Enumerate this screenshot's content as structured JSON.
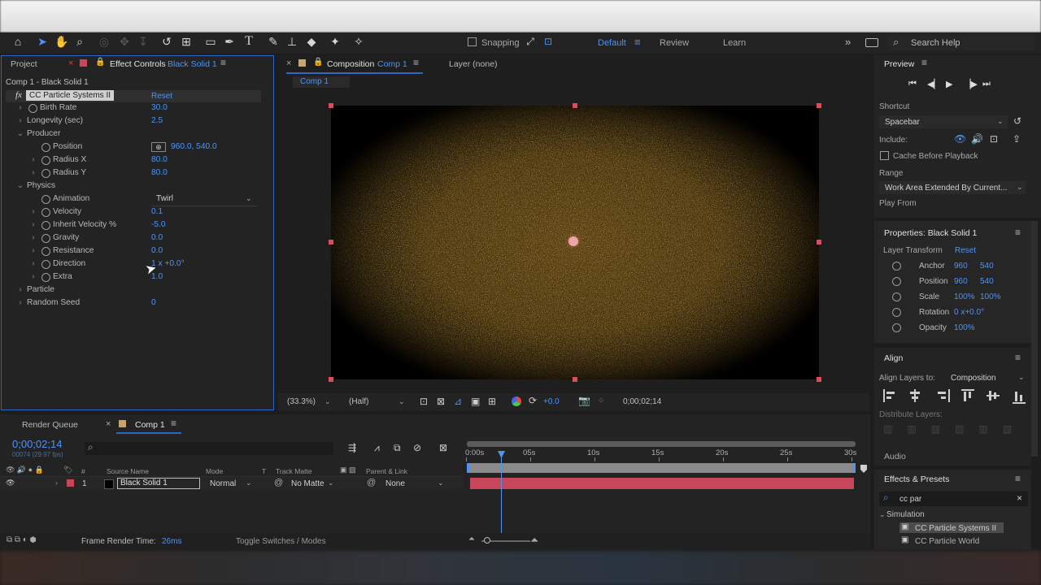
{
  "toolbar": {
    "snapping_label": "Snapping",
    "workspaces": [
      "Default",
      "Review",
      "Learn"
    ],
    "search_help": "Search Help"
  },
  "left_panel": {
    "tab_project": "Project",
    "tab_effect_controls": "Effect Controls",
    "tab_effect_layer": "Black Solid 1",
    "breadcrumb": "Comp 1 - Black Solid 1",
    "effect_name": "CC Particle Systems II",
    "reset": "Reset",
    "params": [
      {
        "label": "Birth Rate",
        "value": "30.0"
      },
      {
        "label": "Longevity (sec)",
        "value": "2.5"
      },
      {
        "label": "Producer",
        "value": ""
      },
      {
        "label": "Position",
        "value": "960.0, 540.0"
      },
      {
        "label": "Radius X",
        "value": "80.0"
      },
      {
        "label": "Radius Y",
        "value": "80.0"
      },
      {
        "label": "Physics",
        "value": ""
      },
      {
        "label": "Animation",
        "value": "Twirl"
      },
      {
        "label": "Velocity",
        "value": "0.1"
      },
      {
        "label": "Inherit Velocity %",
        "value": "-5.0"
      },
      {
        "label": "Gravity",
        "value": "0.0"
      },
      {
        "label": "Resistance",
        "value": "0.0"
      },
      {
        "label": "Direction",
        "value": "1 x +0.0°"
      },
      {
        "label": "Extra",
        "value": "1.0"
      },
      {
        "label": "Particle",
        "value": ""
      },
      {
        "label": "Random Seed",
        "value": "0"
      }
    ]
  },
  "comp_panel": {
    "tab_composition": "Composition",
    "tab_comp_name": "Comp 1",
    "tab_layer": "Layer (none)",
    "sub_tab": "Comp 1",
    "zoom": "(33.3%)",
    "resolution": "(Half)",
    "exposure": "+0.0",
    "timecode": "0;00;02;14"
  },
  "preview": {
    "title": "Preview",
    "shortcut_label": "Shortcut",
    "shortcut_value": "Spacebar",
    "include_label": "Include:",
    "cache_label": "Cache Before Playback",
    "range_label": "Range",
    "range_value": "Work Area Extended By Current...",
    "play_from": "Play From"
  },
  "properties": {
    "title": "Properties: Black Solid 1",
    "layer_transform": "Layer Transform",
    "reset": "Reset",
    "rows": [
      {
        "label": "Anchor",
        "v1": "960",
        "v2": "540"
      },
      {
        "label": "Position",
        "v1": "960",
        "v2": "540"
      },
      {
        "label": "Scale",
        "v1": "100%",
        "v2": "100%"
      },
      {
        "label": "Rotation",
        "v1": "0 x+0.0°",
        "v2": ""
      },
      {
        "label": "Opacity",
        "v1": "100%",
        "v2": ""
      }
    ]
  },
  "align": {
    "title": "Align",
    "align_layers_to": "Align Layers to:",
    "align_target": "Composition",
    "distribute": "Distribute Layers:"
  },
  "audio": {
    "title": "Audio"
  },
  "effects_presets": {
    "title": "Effects & Presets",
    "search": "cc par",
    "category": "Simulation",
    "items": [
      "CC Particle Systems II",
      "CC Particle World"
    ]
  },
  "timeline": {
    "tab_render_queue": "Render Queue",
    "tab_comp": "Comp 1",
    "timecode": "0;00;02;14",
    "timecode_sub": "00074 (29.97 fps)",
    "col_hash": "#",
    "col_source": "Source Name",
    "col_mode": "Mode",
    "col_t": "T",
    "col_track_matte": "Track Matte",
    "col_parent": "Parent & Link",
    "layer_num": "1",
    "layer_name": "Black Solid 1",
    "layer_mode": "Normal",
    "layer_matte": "No Matte",
    "layer_parent": "None",
    "ruler": [
      "0:00s",
      "05s",
      "10s",
      "15s",
      "20s",
      "25s",
      "30s"
    ],
    "frame_render_label": "Frame Render Time:",
    "frame_render_value": "26ms",
    "toggle_label": "Toggle Switches / Modes"
  },
  "colors": {
    "accent": "#4f94f3",
    "layer_bar": "#c8465a",
    "handle": "#e04a5a",
    "particle": "#b98a2a"
  }
}
